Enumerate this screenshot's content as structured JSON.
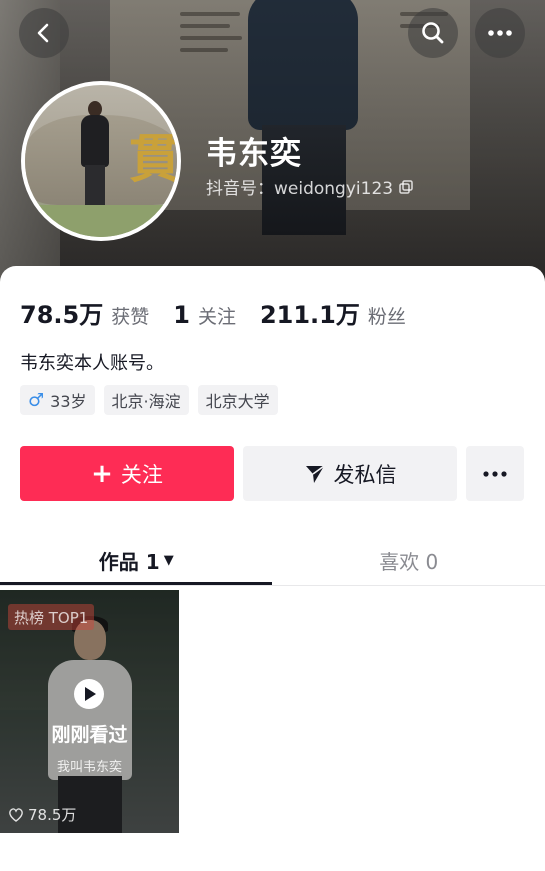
{
  "profile": {
    "name": "韦东奕",
    "douyin_id": "抖音号：weidongyi123",
    "bio": "韦东奕本人账号。"
  },
  "stats": [
    {
      "value": "78.5万",
      "label": "获赞"
    },
    {
      "value": "1",
      "label": "关注"
    },
    {
      "value": "211.1万",
      "label": "粉丝"
    }
  ],
  "tags": {
    "gender_icon": "male-icon",
    "age": "33岁",
    "location": "北京·海淀",
    "school": "北京大学"
  },
  "actions": {
    "follow_label": "关注",
    "message_label": "发私信"
  },
  "tabs": {
    "works_label": "作品 1",
    "likes_label": "喜欢 0"
  },
  "video": {
    "hot_badge": "热榜 TOP1",
    "recently_viewed": "刚刚看过",
    "caption": "我叫韦东奕",
    "likes": "78.5万"
  },
  "colors": {
    "accent": "#fe2c55",
    "text_primary": "#161823",
    "text_secondary": "#6b6d75",
    "chip_bg": "#f2f2f4",
    "male_blue": "#3a8ee8"
  },
  "icons": [
    "back-icon",
    "search-icon",
    "more-icon",
    "copy-icon",
    "plus-icon",
    "send-icon",
    "caret-down-icon",
    "play-icon",
    "heart-icon"
  ]
}
